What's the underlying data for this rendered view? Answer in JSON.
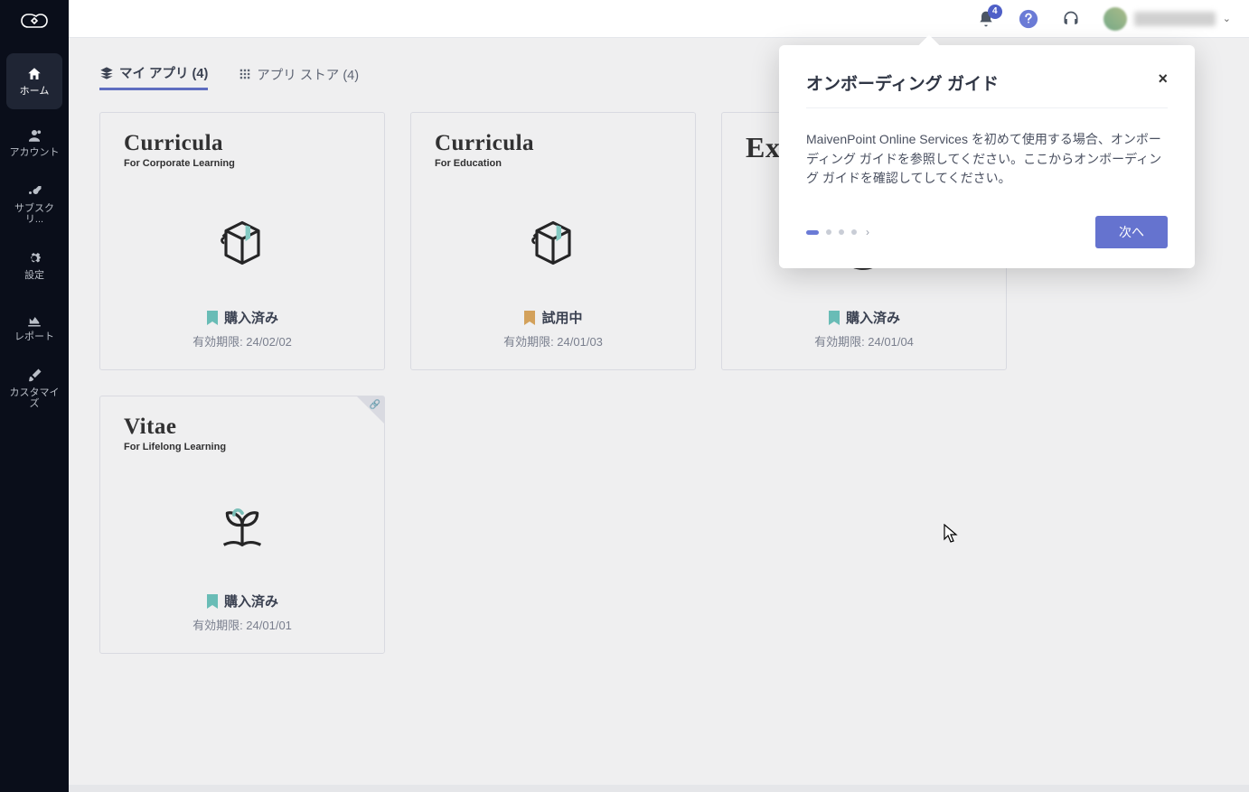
{
  "sidebar": {
    "items": [
      {
        "label": "ホーム",
        "icon": "home",
        "active": true
      },
      {
        "label": "アカウント",
        "icon": "users",
        "active": false
      },
      {
        "label": "サブスクリ...",
        "icon": "key",
        "active": false
      },
      {
        "label": "設定",
        "icon": "gear",
        "active": false
      },
      {
        "label": "レポート",
        "icon": "chart",
        "active": false
      },
      {
        "label": "カスタマイズ",
        "icon": "brush",
        "active": false
      }
    ]
  },
  "topbar": {
    "notification_count": "4"
  },
  "tabs": {
    "my_apps": "マイ アプリ (4)",
    "app_store": "アプリ ストア (4)"
  },
  "cards": [
    {
      "title": "Curricula",
      "subtitle": "For Corporate Learning",
      "status": "購入済み",
      "status_color": "teal",
      "expiry": "有効期限: 24/02/02",
      "icon": "box"
    },
    {
      "title": "Curricula",
      "subtitle": "For Education",
      "status": "試用中",
      "status_color": "orange",
      "expiry": "有効期限: 24/01/03",
      "icon": "box"
    },
    {
      "title": "Ex",
      "subtitle": "",
      "status": "購入済み",
      "status_color": "teal",
      "expiry": "有効期限: 24/01/04",
      "icon": "cycle"
    },
    {
      "title": "Vitae",
      "subtitle": "For Lifelong Learning",
      "status": "購入済み",
      "status_color": "teal",
      "expiry": "有効期限: 24/01/01",
      "icon": "plant",
      "link": true
    }
  ],
  "popover": {
    "title": "オンボーディング ガイド",
    "body": "MaivenPoint Online Services を初めて使用する場合、オンボーディング ガイドを参照してください。ここからオンボーディング ガイドを確認してしてください。",
    "next": "次へ"
  }
}
